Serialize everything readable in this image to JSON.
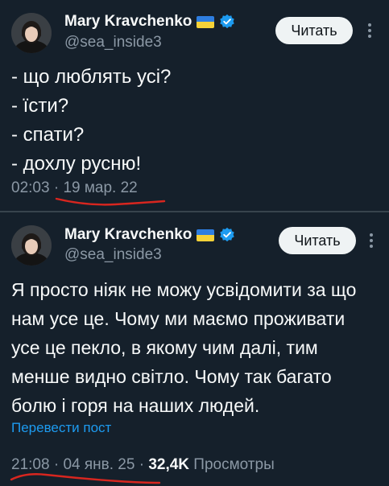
{
  "tweets": [
    {
      "author": {
        "name": "Mary Kravchenko",
        "handle": "@sea_inside3"
      },
      "follow_label": "Читать",
      "lines": [
        "- що люблять усі?",
        "- їсти?",
        "- спати?",
        "- дохлу русню!"
      ],
      "time": "02:03",
      "separator": "·",
      "date": "19 мар. 22"
    },
    {
      "author": {
        "name": "Mary Kravchenko",
        "handle": "@sea_inside3"
      },
      "follow_label": "Читать",
      "lines": [
        "Я просто ніяк не можу усвідомити за що",
        "нам усе це. Чому ми маємо проживати",
        "усе це пекло, в якому чим далі, тим",
        "менше видно світло. Чому так багато",
        "болю і горя на наших людей."
      ],
      "translate_label": "Перевести пост",
      "time": "21:08",
      "separator": "·",
      "date": "04 янв. 25",
      "views_count": "32,4K",
      "views_label": "Просмотры"
    }
  ],
  "colors": {
    "background": "#15202b",
    "text_primary": "#f7f9f9",
    "text_secondary": "#8b98a5",
    "link": "#1d9bf0",
    "underline_annotation": "#d8261f",
    "flag_blue": "#2e7ee0",
    "flag_yellow": "#f6d238",
    "verified_badge": "#1d9bf0"
  },
  "icons": [
    "avatar",
    "ukraine-flag-icon",
    "verified-badge-icon",
    "more-options-icon"
  ]
}
